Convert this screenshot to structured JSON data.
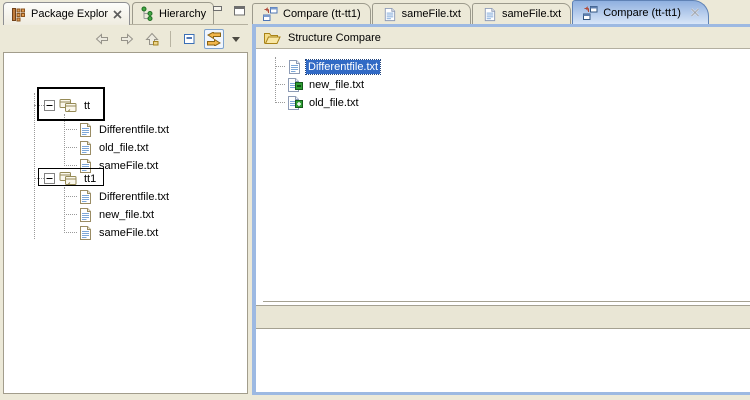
{
  "colors": {
    "workbench_bg": "#ece9d8",
    "selection_blue": "#316ac5",
    "editor_border_blue": "#9db9e2",
    "active_tab_gradient_top": "#8fb0df",
    "active_tab_gradient_bottom": "#d9e6f8",
    "annotation": "#000000"
  },
  "left_panel": {
    "tabs": [
      {
        "label": "Package Explor",
        "active": true,
        "closable": true
      },
      {
        "label": "Hierarchy",
        "active": false
      }
    ],
    "toolbar": {
      "icons": [
        "back",
        "forward",
        "up",
        "collapse-all",
        "link-with-editor",
        "view-menu"
      ],
      "link_with_editor_pressed": true
    },
    "tree": {
      "projects": [
        {
          "label": "tt",
          "expanded": true,
          "annotated": true,
          "children": [
            "Differentfile.txt",
            "old_file.txt",
            "sameFile.txt"
          ]
        },
        {
          "label": "tt1",
          "expanded": true,
          "annotated": true,
          "children": [
            "Differentfile.txt",
            "new_file.txt",
            "sameFile.txt"
          ]
        }
      ]
    }
  },
  "editor": {
    "tabs": [
      {
        "label": "Compare (tt-tt1)",
        "icon": "compare",
        "active": false
      },
      {
        "label": "sameFile.txt",
        "icon": "text-file",
        "active": false
      },
      {
        "label": "sameFile.txt",
        "icon": "text-file",
        "active": false
      },
      {
        "label": "Compare (tt-tt1)",
        "icon": "compare",
        "active": true,
        "closable": true
      }
    ],
    "structure_compare": {
      "title": "Structure Compare",
      "items": [
        {
          "label": "Differentfile.txt",
          "selected": true,
          "change": "modified"
        },
        {
          "label": "new_file.txt",
          "selected": false,
          "change": "removed"
        },
        {
          "label": "old_file.txt",
          "selected": false,
          "change": "added"
        }
      ]
    }
  }
}
